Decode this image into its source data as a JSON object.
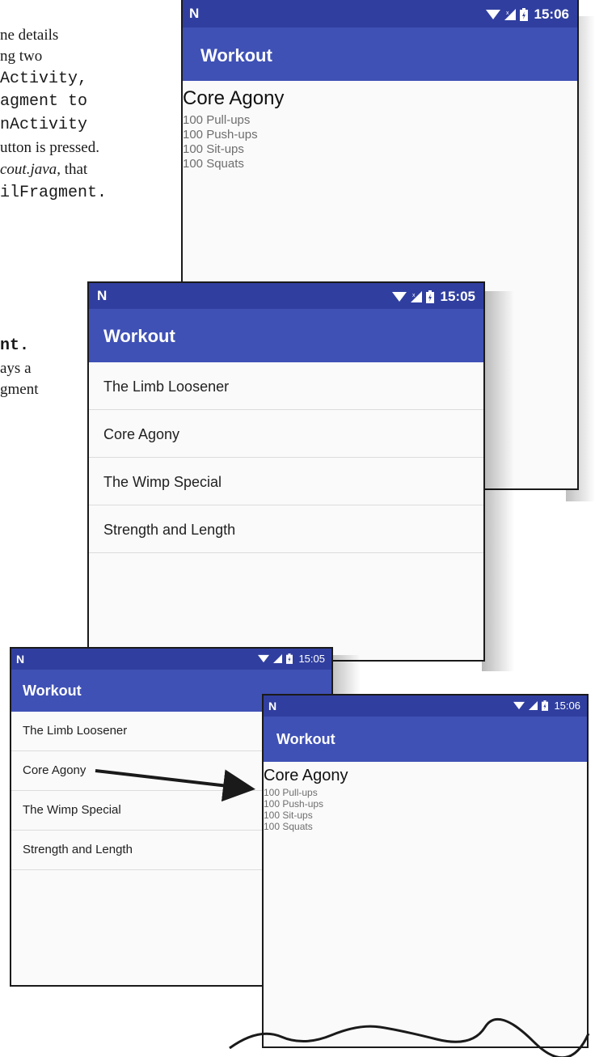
{
  "book_text": {
    "line1": "ne details",
    "line2": "ng two",
    "line3": "Activity,",
    "line4": "agment to",
    "line5": "nActivity",
    "line6": "utton is pressed.",
    "line7a": "cout.java",
    "line7b": ", that",
    "line8": "ilFragment.",
    "line9": "nt.",
    "line10": "ays a",
    "line11": "gment"
  },
  "screens": {
    "detail_top": {
      "time": "15:06",
      "app_title": "Workout",
      "workout_title": "Core Agony",
      "exercises": [
        "100 Pull-ups",
        "100 Push-ups",
        "100 Sit-ups",
        "100 Squats"
      ]
    },
    "list_middle": {
      "time": "15:05",
      "app_title": "Workout",
      "items": [
        "The Limb Loosener",
        "Core Agony",
        "The Wimp Special",
        "Strength and Length"
      ]
    },
    "list_bottom": {
      "time": "15:05",
      "app_title": "Workout",
      "items": [
        "The Limb Loosener",
        "Core Agony",
        "The Wimp Special",
        "Strength and Length"
      ]
    },
    "detail_bottom": {
      "time": "15:06",
      "app_title": "Workout",
      "workout_title": "Core Agony",
      "exercises": [
        "100 Pull-ups",
        "100 Push-ups",
        "100 Sit-ups",
        "100 Squats"
      ]
    }
  },
  "colors": {
    "status_bar": "#303f9f",
    "app_bar": "#3f51b5",
    "background": "#fafafa"
  },
  "icons": {
    "logo": "nougat-n-logo",
    "wifi": "wifi-icon",
    "signal": "signal-icon",
    "battery": "battery-charging-icon"
  }
}
